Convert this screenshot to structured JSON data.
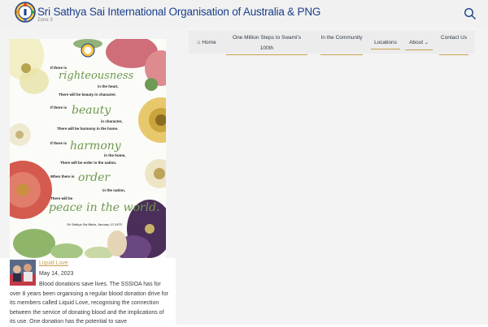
{
  "header": {
    "title": "Sri Sathya Sai International Organisation of Australia & PNG",
    "subtitle": "Zone 3",
    "search_icon": "search-icon"
  },
  "nav": {
    "home_label": "Home",
    "home_icon": "home-icon",
    "million_steps_label": "One Million Steps to Swami's 100th",
    "community_label": "In the Community",
    "locations_label": "Locations",
    "about_label": "About",
    "about_icon": "chevron-down-icon",
    "contact_label": "Contact Us"
  },
  "poster": {
    "lines": [
      {
        "a": "If there is",
        "b": "righteousness",
        "c": "in the heart,",
        "d": "There will be beauty in character."
      },
      {
        "a": "If there is",
        "b": "beauty",
        "c": "in character,",
        "d": "There will be harmony in the home."
      },
      {
        "a": "If there is",
        "b": "harmony",
        "c": "in the home,",
        "d": "There will be order in the nation."
      },
      {
        "a": "When there is",
        "b": "order",
        "c": "in the nation,",
        "d": "There will be"
      }
    ],
    "finale": "peace in the world.",
    "attribution": "Sri Sathya Sai Baba, January 13 1970"
  },
  "post": {
    "link_text": "Liquid Love",
    "date": "May 14, 2023",
    "excerpt": "Blood donations save lives. The SSSIOA has for over 8 years been organising a regular blood donation drive for its members called Liquid Love, recognising the connection between the service of donating blood and the implications of its use. One donation has the potential to save"
  },
  "colors": {
    "header_bg": "#f1f1f1",
    "title_blue": "#1b3f8b",
    "accent_gold": "#c8a04d",
    "script_green": "#6e9a4f"
  }
}
